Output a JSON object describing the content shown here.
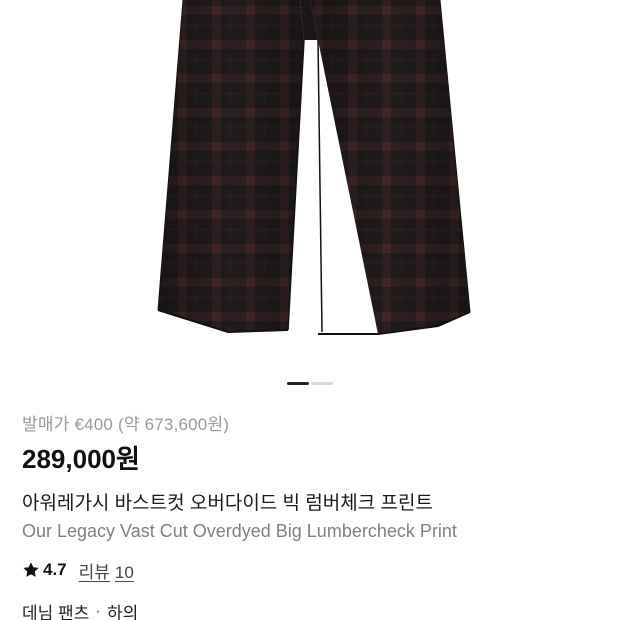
{
  "product_image": {
    "icon": "product-photo-pants",
    "colors": {
      "base": "#1f1a1b",
      "check": "#3a2424",
      "check_accent": "#4a2b2b"
    },
    "carousel": {
      "total": 2,
      "current": 1
    }
  },
  "price": {
    "original_label": "발매가 €400 (약 673,600원)",
    "current": "289,000원"
  },
  "product": {
    "name_ko": "아워레가시 바스트컷 오버다이드 빅 럼버체크 프린트",
    "name_en": "Our Legacy Vast Cut Overdyed Big Lumbercheck Print"
  },
  "rating": {
    "icon": "star-icon",
    "value": "4.7",
    "review_label": "리뷰",
    "review_count": "10"
  },
  "category": {
    "primary": "데님 팬츠",
    "separator": "·",
    "secondary": "하의"
  },
  "colors": {
    "text_primary": "#111111",
    "text_secondary": "#808080",
    "text_muted": "#9a9a9a",
    "pager_active": "#222222",
    "pager_inactive": "#d9d9d9"
  }
}
